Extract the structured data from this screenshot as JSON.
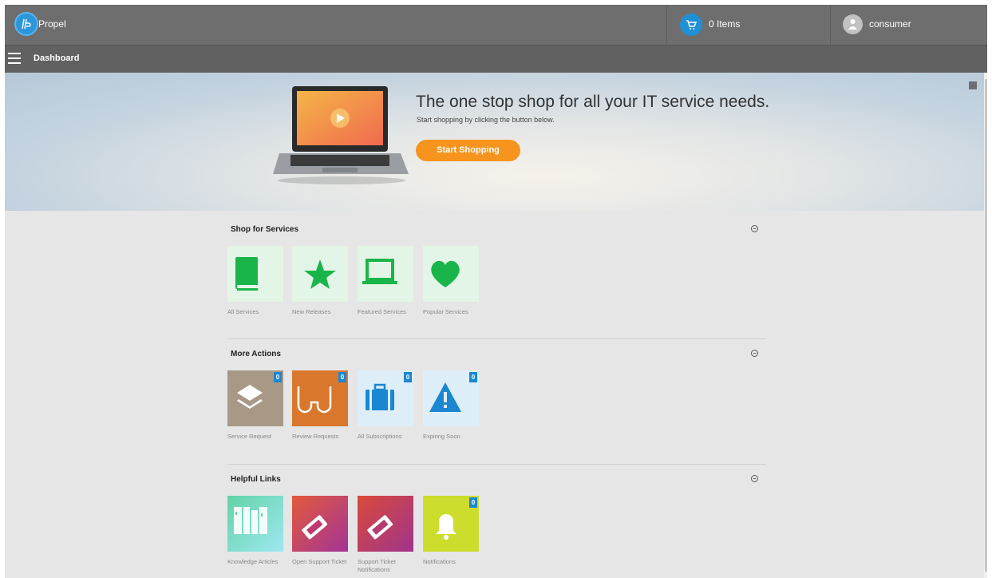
{
  "app": {
    "name": "Propel"
  },
  "header": {
    "cart_label": "0 Items",
    "user_name": "consumer"
  },
  "nav": {
    "title": "Dashboard"
  },
  "hero": {
    "title": "The one stop shop for all your IT service needs.",
    "subtitle": "Start shopping by clicking the button below.",
    "button_label": "Start Shopping"
  },
  "sections": [
    {
      "title": "Shop for Services",
      "tiles": [
        {
          "label": "All Services",
          "icon": "book-icon",
          "bg": "#e3f5e6"
        },
        {
          "label": "New Releases",
          "icon": "star-icon",
          "bg": "#e3f5e6"
        },
        {
          "label": "Featured Services",
          "icon": "laptop-icon",
          "bg": "#e3f5e6"
        },
        {
          "label": "Popular Services",
          "icon": "heart-icon",
          "bg": "#e3f5e6"
        }
      ]
    },
    {
      "title": "More Actions",
      "tiles": [
        {
          "label": "Service Request",
          "icon": "layers-icon",
          "bg": "#a89886",
          "badge": "0"
        },
        {
          "label": "Review Requests",
          "icon": "glasses-icon",
          "bg": "#d9782c",
          "badge": "0"
        },
        {
          "label": "All Subscriptions",
          "icon": "briefcase-icon",
          "bg": "#deeef9",
          "badge": "0"
        },
        {
          "label": "Expiring Soon",
          "icon": "warning-icon",
          "bg": "#deeef9",
          "badge": "0"
        }
      ]
    },
    {
      "title": "Helpful Links",
      "tiles": [
        {
          "label": "Knowledge Articles",
          "icon": "bookshelf-icon",
          "bg": "#7fd9c9"
        },
        {
          "label": "Open Support Ticket",
          "icon": "ticket-icon",
          "bg": "#c0396e"
        },
        {
          "label": "Support Ticket Notifications",
          "icon": "ticket-icon",
          "bg": "#b63b72"
        },
        {
          "label": "Notifications",
          "icon": "bell-icon",
          "bg": "#cddd2d",
          "badge": "0"
        }
      ]
    }
  ],
  "colors": {
    "topbar": "#6e6e6e",
    "accent_orange": "#f7941d",
    "badge_blue": "#1b87d0",
    "green_icon": "#19b54a"
  }
}
